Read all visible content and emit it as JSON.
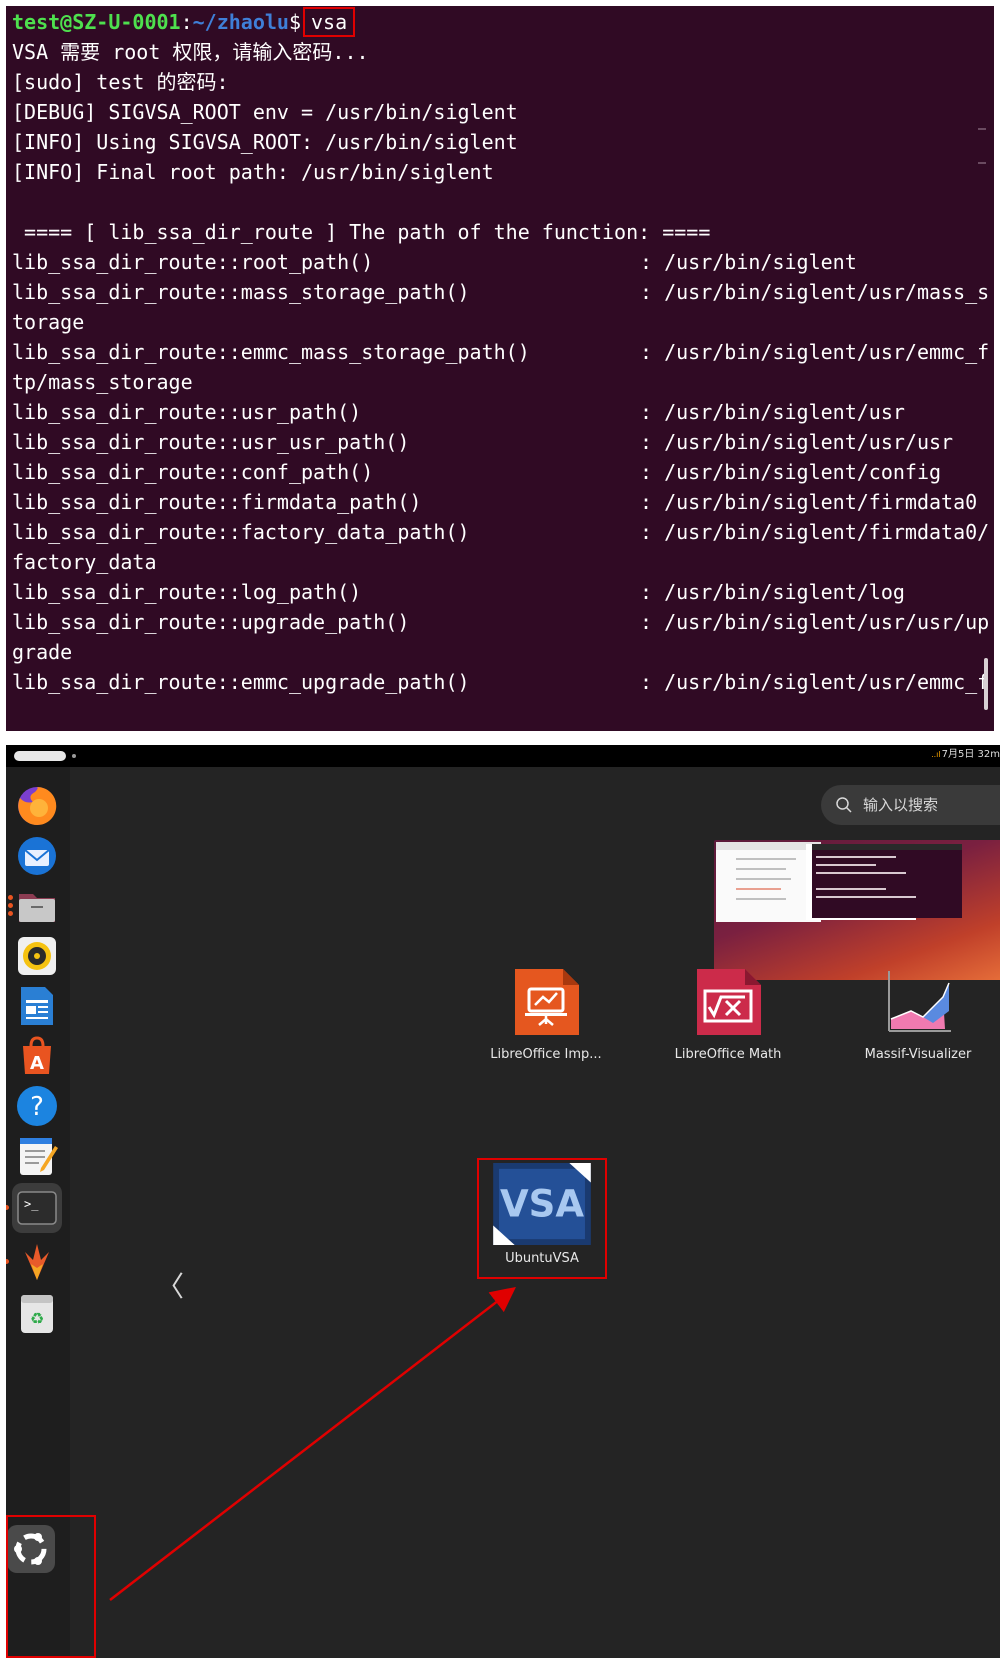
{
  "terminal": {
    "prompt_user": "test@SZ-U-0001",
    "prompt_colon": ":",
    "prompt_path": "~/zhaolu",
    "prompt_symbol": "$",
    "command": "vsa",
    "lines": [
      "VSA 需要 root 权限，请输入密码...",
      "[sudo] test 的密码:",
      "[DEBUG] SIGVSA_ROOT env = /usr/bin/siglent",
      "[INFO] Using SIGVSA_ROOT: /usr/bin/siglent",
      "[INFO] Final root path: /usr/bin/siglent",
      "",
      " ==== [ lib_ssa_dir_route ] The path of the function: ===="
    ],
    "routes": [
      {
        "name": "lib_ssa_dir_route::root_path()",
        "value": ": /usr/bin/siglent",
        "wrap": ""
      },
      {
        "name": "lib_ssa_dir_route::mass_storage_path()",
        "value": ": /usr/bin/siglent/usr/mass_s",
        "wrap": "torage"
      },
      {
        "name": "lib_ssa_dir_route::emmc_mass_storage_path()",
        "value": ": /usr/bin/siglent/usr/emmc_f",
        "wrap": "tp/mass_storage"
      },
      {
        "name": "lib_ssa_dir_route::usr_path()",
        "value": ": /usr/bin/siglent/usr",
        "wrap": ""
      },
      {
        "name": "lib_ssa_dir_route::usr_usr_path()",
        "value": ": /usr/bin/siglent/usr/usr",
        "wrap": ""
      },
      {
        "name": "lib_ssa_dir_route::conf_path()",
        "value": ": /usr/bin/siglent/config",
        "wrap": ""
      },
      {
        "name": "lib_ssa_dir_route::firmdata_path()",
        "value": ": /usr/bin/siglent/firmdata0",
        "wrap": ""
      },
      {
        "name": "lib_ssa_dir_route::factory_data_path()",
        "value": ": /usr/bin/siglent/firmdata0/",
        "wrap": "factory_data"
      },
      {
        "name": "lib_ssa_dir_route::log_path()",
        "value": ": /usr/bin/siglent/log",
        "wrap": ""
      },
      {
        "name": "lib_ssa_dir_route::upgrade_path()",
        "value": ": /usr/bin/siglent/usr/usr/up",
        "wrap": "grade"
      },
      {
        "name": "lib_ssa_dir_route::emmc_upgrade_path()",
        "value": ": /usr/bin/siglent/usr/emmc_f",
        "wrap": ""
      }
    ]
  },
  "topbar": {
    "signal": "..ıl",
    "clock": "7月5日 32m"
  },
  "search": {
    "placeholder": "输入以搜索"
  },
  "apps": [
    {
      "label": "LibreOffice Imp...",
      "icon": "libreoffice-impress-icon"
    },
    {
      "label": "LibreOffice Math",
      "icon": "libreoffice-math-icon"
    },
    {
      "label": "Massif-Visualizer",
      "icon": "massif-visualizer-icon"
    },
    {
      "label": "UbuntuVSA",
      "icon": "ubuntu-vsa-icon",
      "icon_text": "VSA"
    }
  ],
  "dock": [
    "firefox-icon",
    "thunderbird-icon",
    "files-icon",
    "rhythmbox-icon",
    "libreoffice-writer-icon",
    "app-center-icon",
    "help-icon",
    "text-editor-icon",
    "terminal-icon",
    "siglent-icon",
    "trash-icon"
  ],
  "nav": {
    "prev": "〈"
  },
  "colors": {
    "terminal_bg": "#300a24",
    "desktop_bg": "#242424",
    "highlight": "#e00000",
    "ubuntu_orange": "#e95420"
  }
}
